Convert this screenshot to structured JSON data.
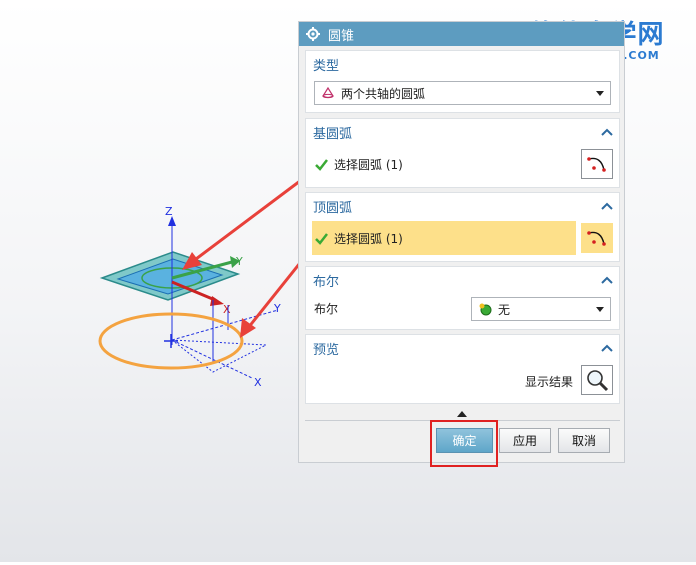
{
  "watermark": {
    "main": "软件自学网",
    "sub": "WWW.RJZXW.COM"
  },
  "viewport": {
    "axis_labels": {
      "z": "Z",
      "y": "Y",
      "x": "X",
      "y2": "Y",
      "x2": "X"
    }
  },
  "dialog": {
    "title": "圆锥",
    "type_section": {
      "label": "类型",
      "selected": "两个共轴的圆弧"
    },
    "base_arc": {
      "label": "基圆弧",
      "select_text": "选择圆弧 (1)"
    },
    "top_arc": {
      "label": "顶圆弧",
      "select_text": "选择圆弧 (1)"
    },
    "boolean": {
      "header": "布尔",
      "field_label": "布尔",
      "selected": "无"
    },
    "preview": {
      "header": "预览",
      "show_result_label": "显示结果"
    },
    "buttons": {
      "ok": "确定",
      "apply": "应用",
      "cancel": "取消"
    }
  },
  "colors": {
    "title_bar": "#5d9cc0",
    "section_header_text": "#2d6aa0",
    "highlight_row": "#fde08a",
    "highlight_box": "#e02121",
    "arrow": "#e8413a",
    "orange_circle": "#f4a340",
    "check": "#3aaa35"
  }
}
